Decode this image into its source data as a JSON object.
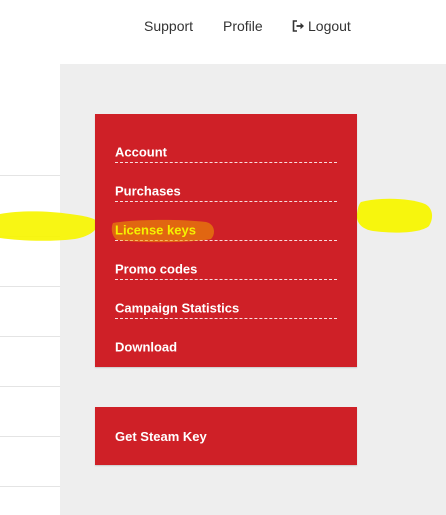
{
  "topnav": {
    "support": "Support",
    "profile": "Profile",
    "logout": "Logout",
    "logout_icon": "sign-out-icon"
  },
  "menu": {
    "items": [
      {
        "label": "Account"
      },
      {
        "label": "Purchases"
      },
      {
        "label": "License keys",
        "active": true
      },
      {
        "label": "Promo codes"
      },
      {
        "label": "Campaign Statistics"
      },
      {
        "label": "Download"
      }
    ]
  },
  "steam": {
    "label": "Get Steam Key"
  },
  "colors": {
    "brand_red": "#cf2027",
    "highlight_yellow": "#f5f200",
    "content_bg": "#eeeeee",
    "nav_text": "#333333"
  }
}
